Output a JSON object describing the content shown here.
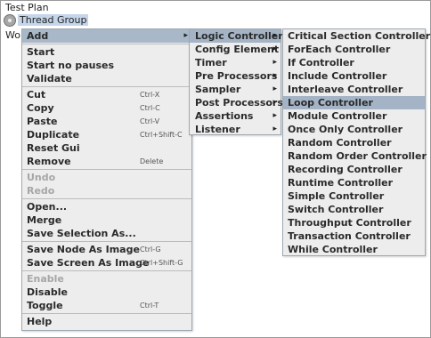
{
  "tree": {
    "test_plan": "Test Plan",
    "thread_group": "Thread Group",
    "workbench_partial": "Wor"
  },
  "main_menu": {
    "items": [
      {
        "label": "Add",
        "has_submenu": true,
        "highlighted": true
      },
      {
        "separator": true
      },
      {
        "label": "Start"
      },
      {
        "label": "Start no pauses"
      },
      {
        "label": "Validate"
      },
      {
        "separator": true
      },
      {
        "label": "Cut",
        "shortcut": "Ctrl-X"
      },
      {
        "label": "Copy",
        "shortcut": "Ctrl-C"
      },
      {
        "label": "Paste",
        "shortcut": "Ctrl-V"
      },
      {
        "label": "Duplicate",
        "shortcut": "Ctrl+Shift-C"
      },
      {
        "label": "Reset Gui"
      },
      {
        "label": "Remove",
        "shortcut": "Delete"
      },
      {
        "separator": true
      },
      {
        "label": "Undo",
        "disabled": true
      },
      {
        "label": "Redo",
        "disabled": true
      },
      {
        "separator": true
      },
      {
        "label": "Open..."
      },
      {
        "label": "Merge"
      },
      {
        "label": "Save Selection As..."
      },
      {
        "separator": true
      },
      {
        "label": "Save Node As Image",
        "shortcut": "Ctrl-G"
      },
      {
        "label": "Save Screen As Image",
        "shortcut": "Ctrl+Shift-G"
      },
      {
        "separator": true
      },
      {
        "label": "Enable",
        "disabled": true
      },
      {
        "label": "Disable"
      },
      {
        "label": "Toggle",
        "shortcut": "Ctrl-T"
      },
      {
        "separator": true
      },
      {
        "label": "Help"
      }
    ]
  },
  "add_menu": {
    "items": [
      {
        "label": "Logic Controller",
        "has_submenu": true,
        "highlighted": true
      },
      {
        "label": "Config Element",
        "has_submenu": true
      },
      {
        "label": "Timer",
        "has_submenu": true
      },
      {
        "label": "Pre Processors",
        "has_submenu": true
      },
      {
        "label": "Sampler",
        "has_submenu": true
      },
      {
        "label": "Post Processors",
        "has_submenu": true
      },
      {
        "label": "Assertions",
        "has_submenu": true
      },
      {
        "label": "Listener",
        "has_submenu": true
      }
    ]
  },
  "logic_menu": {
    "items": [
      {
        "label": "Critical Section Controller"
      },
      {
        "label": "ForEach Controller"
      },
      {
        "label": "If Controller"
      },
      {
        "label": "Include Controller"
      },
      {
        "label": "Interleave Controller"
      },
      {
        "label": "Loop Controller",
        "highlighted": true
      },
      {
        "label": "Module Controller"
      },
      {
        "label": "Once Only Controller"
      },
      {
        "label": "Random Controller"
      },
      {
        "label": "Random Order Controller"
      },
      {
        "label": "Recording Controller"
      },
      {
        "label": "Runtime Controller"
      },
      {
        "label": "Simple Controller"
      },
      {
        "label": "Switch Controller"
      },
      {
        "label": "Throughput Controller"
      },
      {
        "label": "Transaction Controller"
      },
      {
        "label": "While Controller"
      }
    ]
  },
  "icons": {
    "submenu_arrow": "▸",
    "thread_group": "gear-icon"
  },
  "colors": {
    "menu_bg": "#ededed",
    "highlight": "#a4b4c6",
    "tree_selection": "#c5d5ea",
    "disabled_text": "#a6a6a6"
  }
}
